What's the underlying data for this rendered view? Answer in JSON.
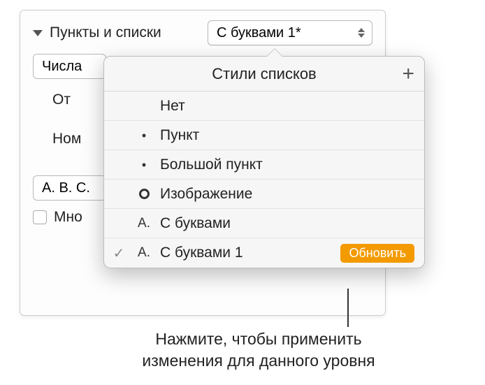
{
  "panel": {
    "section_label": "Пункты и списки",
    "style_dropdown_value": "С буквами 1*",
    "secondary_value": "Числа",
    "indent_label": "От",
    "number_label": "Ном",
    "preview_value": "A. B. C.",
    "checkbox_label": "Мно"
  },
  "popover": {
    "title": "Стили списков",
    "add_icon": "+",
    "items": [
      {
        "marker": "",
        "label": "Нет",
        "selected": false
      },
      {
        "marker": "dot",
        "label": "Пункт",
        "selected": false
      },
      {
        "marker": "dot",
        "label": "Большой пункт",
        "selected": false
      },
      {
        "marker": "ring",
        "label": "Изображение",
        "selected": false
      },
      {
        "marker": "A.",
        "label": "С буквами",
        "selected": false
      },
      {
        "marker": "A.",
        "label": "С буквами 1",
        "selected": true,
        "action": "Обновить"
      }
    ]
  },
  "callout": {
    "line1": "Нажмите, чтобы применить",
    "line2": "изменения для данного уровня"
  }
}
